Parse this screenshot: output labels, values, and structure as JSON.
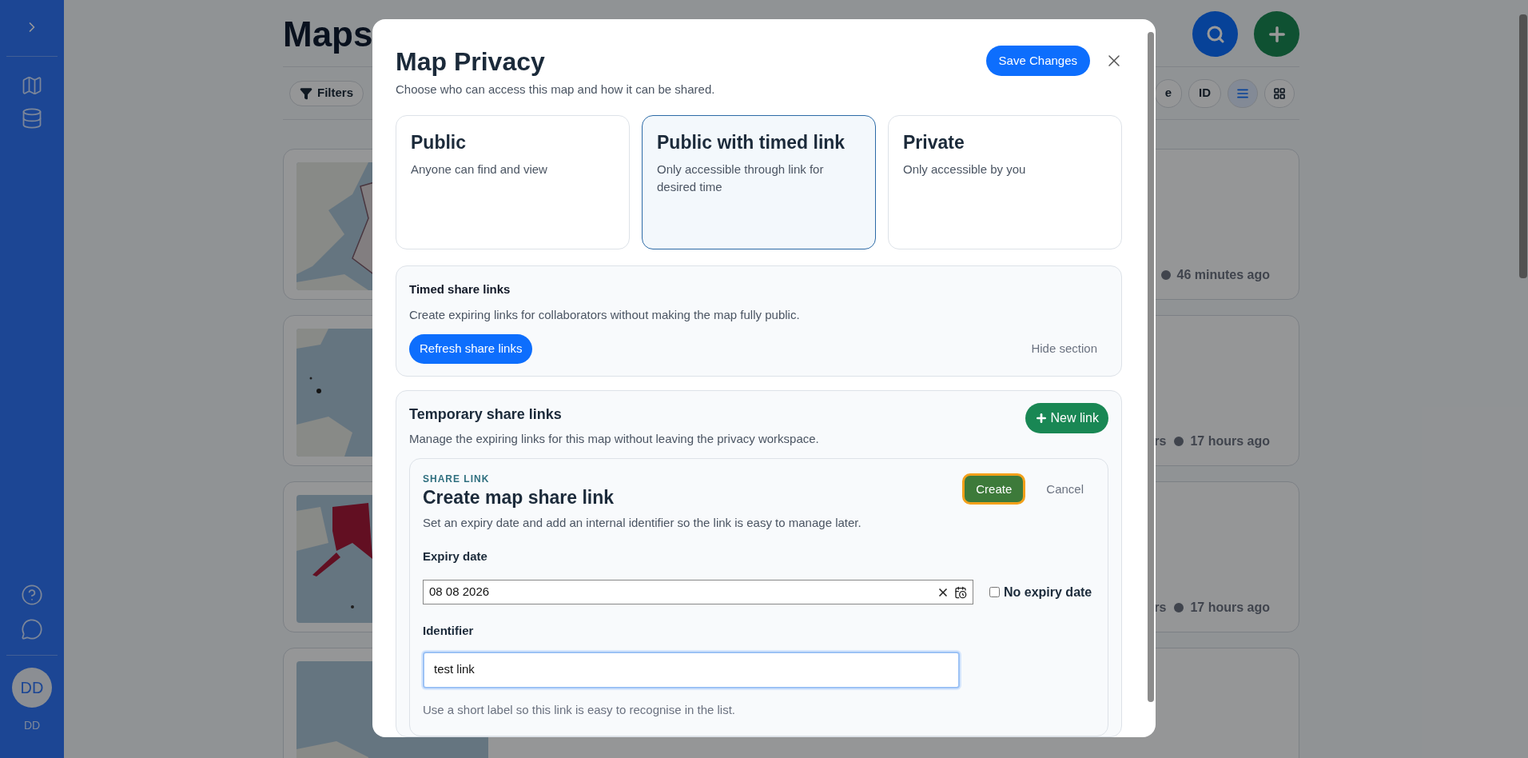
{
  "sidebar": {
    "avatar": "DD",
    "user": "DD"
  },
  "page": {
    "title": "Maps",
    "filters": "Filters",
    "sort_options": [
      {
        "label": "e",
        "selected": false
      },
      {
        "label": "ID",
        "selected": false
      }
    ],
    "views": [
      {
        "kind": "list",
        "selected": true
      },
      {
        "kind": "grid",
        "selected": false
      }
    ],
    "cards": [
      {
        "map": {
          "kind": "picture"
        },
        "time": "46 minutes ago"
      },
      {
        "map": {
          "kind": "picture"
        },
        "stat": "rs",
        "time": "17 hours ago"
      },
      {
        "map": {
          "kind": "picture"
        },
        "stat": "rs",
        "time": "17 hours ago"
      },
      {
        "map": {
          "kind": "picture"
        }
      }
    ]
  },
  "modal": {
    "title": "Map Privacy",
    "subtitle": "Choose who can access this map and how it can be shared.",
    "save": "Save Changes",
    "options": [
      {
        "title": "Public",
        "description": "Anyone can find and view",
        "selected": false
      },
      {
        "title": "Public with timed link",
        "description": "Only accessible through link for desired time",
        "selected": true
      },
      {
        "title": "Private",
        "description": "Only accessible by you",
        "selected": false
      }
    ],
    "timed": {
      "title": "Timed share links",
      "description": "Create expiring links for collaborators without making the map fully public.",
      "refresh": "Refresh share links",
      "hide": "Hide section"
    },
    "temporary": {
      "title": "Temporary share links",
      "description": "Manage the expiring links for this map without leaving the privacy workspace.",
      "new_link": "New link",
      "form": {
        "eyebrow": "SHARE LINK",
        "title": "Create map share link",
        "description": "Set an expiry date and add an internal identifier so the link is easy to manage later.",
        "create": "Create",
        "cancel": "Cancel",
        "expiry_label": "Expiry date",
        "expiry_value": "08 08 2026",
        "no_expiry": {
          "label": "No expiry date",
          "checked": false
        },
        "identifier_label": "Identifier",
        "identifier_value": "test link",
        "hint": "Use a short label so this link is easy to recognise in the list."
      }
    }
  }
}
